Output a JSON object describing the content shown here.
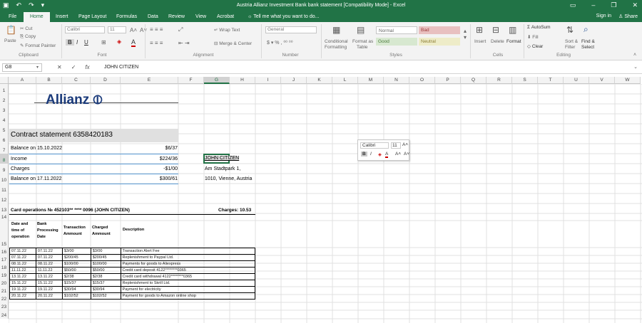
{
  "window": {
    "title": "Austria Allianz Investment Bank bank statement  [Compatibility Mode] - Excel",
    "save_icon": "save-icon",
    "undo_icon": "undo-icon",
    "redo_icon": "redo-icon"
  },
  "tabs": [
    "File",
    "Home",
    "Insert",
    "Page Layout",
    "Formulas",
    "Data",
    "Review",
    "View",
    "Acrobat"
  ],
  "tell_me": "Tell me what you want to do...",
  "signin": "Sign in",
  "share": "Share",
  "ribbon": {
    "clipboard": {
      "paste": "Paste",
      "cut": "Cut",
      "copy": "Copy",
      "format_painter": "Format Painter",
      "label": "Clipboard"
    },
    "font": {
      "name": "Calibri",
      "size": "11",
      "bold": "B",
      "italic": "I",
      "underline": "U",
      "label": "Font"
    },
    "alignment": {
      "wrap": "Wrap Text",
      "merge": "Merge & Center",
      "label": "Alignment"
    },
    "number": {
      "format": "General",
      "label": "Number"
    },
    "styles": {
      "conditional": "Conditional",
      "formatting": "Formatting",
      "format_as": "Format as",
      "table": "Table",
      "normal": "Normal",
      "bad": "Bad",
      "good": "Good",
      "neutral": "Neutral",
      "label": "Styles"
    },
    "cells": {
      "insert": "Insert",
      "delete": "Delete",
      "format": "Format",
      "label": "Cells"
    },
    "editing": {
      "autosum": "AutoSum",
      "fill": "Fill",
      "clear": "Clear",
      "sort": "Sort &",
      "filter": "Filter",
      "find": "Find &",
      "select": "Select",
      "label": "Editing"
    }
  },
  "formula_bar": {
    "name_box": "G8",
    "value": "JOHN CITIZEN"
  },
  "columns": [
    "A",
    "B",
    "C",
    "D",
    "E",
    "F",
    "G",
    "H",
    "I",
    "J",
    "K",
    "L",
    "M",
    "N",
    "O",
    "P",
    "Q",
    "R",
    "S",
    "T",
    "U",
    "V",
    "W"
  ],
  "rows": [
    "1",
    "2",
    "3",
    "4",
    "5",
    "6",
    "7",
    "8",
    "9",
    "10",
    "11",
    "12",
    "13",
    "14",
    "15",
    "16",
    "17",
    "18",
    "19",
    "20",
    "21",
    "22",
    "23",
    "24"
  ],
  "logo": "Allianz",
  "statement_title": "Contract statement 6358420183",
  "summary": [
    {
      "label": "Balance on 15.10.2022",
      "value": "$6/37"
    },
    {
      "label": "Income",
      "value": "$224/36"
    },
    {
      "label": "Charges",
      "value": "-$1/00"
    },
    {
      "label": "Balance on 17.11.2022",
      "value": "$300/61"
    }
  ],
  "address": {
    "name": "JOHN CITIZEN",
    "street": "Am Stadtpark 1,",
    "city": "1010, Vienne, Austria"
  },
  "mini_toolbar": {
    "font": "Calibri",
    "size": "11"
  },
  "card_ops": "Card operations № 452103** **** 0096  (JOHN CITIZEN)",
  "charges_total": "Charges: 10.53",
  "headers": {
    "c1": [
      "Date and",
      "time of",
      "operation"
    ],
    "c2": [
      "Bank",
      "Processing",
      "Date"
    ],
    "c3": [
      "Transaction",
      "Ammount"
    ],
    "c4": [
      "Charged",
      "Ammount"
    ],
    "c5": "Description"
  },
  "transactions": [
    [
      "07.11.22",
      "07.11.22",
      "$3/00",
      "$3/00",
      "Transaction Alert Fee"
    ],
    [
      "07.11.22",
      "07.11.22",
      "$200/45",
      "$200/45",
      "Replenishment to Paypal Ltd."
    ],
    [
      "08.11.22",
      "08.11.22",
      "$100/00",
      "$100/00",
      "Payments for goods to Aliexpress"
    ],
    [
      "11.11.22",
      "11.11.22",
      "$50/00",
      "$50/00",
      "Credit card deposit 4122********0365"
    ],
    [
      "13.11.22",
      "13.11.22",
      "$2/38",
      "$2/38",
      "Credit card withdrawal 4122********0365"
    ],
    [
      "15.11.22",
      "15.11.22",
      "$15/37",
      "$15/37",
      "Replenishment to Skrill Ltd."
    ],
    [
      "19.11.22",
      "19.11.22",
      "$30/94",
      "$30/94",
      "Payment for electricity"
    ],
    [
      "20.11.22",
      "20.11.22",
      "$102/52",
      "$102/52",
      "Payment for goods to Amazon online shop"
    ]
  ]
}
